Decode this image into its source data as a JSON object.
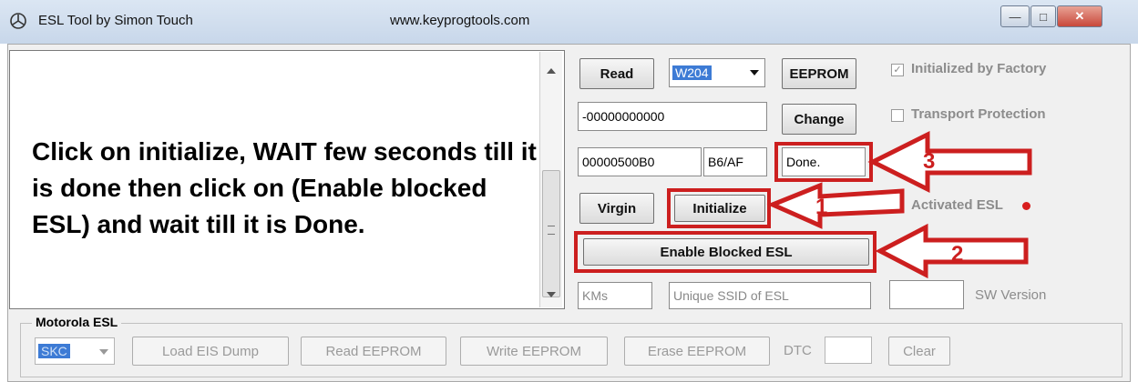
{
  "window": {
    "title": "ESL Tool by Simon Touch",
    "url": "www.keyprogtools.com"
  },
  "instructions": "Click on initialize, WAIT few seconds till it is done then click on (Enable blocked ESL) and wait till it is Done.",
  "controls": {
    "read_label": "Read",
    "model_value": "W204",
    "eeprom_label": "EEPROM",
    "initialized_label": "Initialized by Factory",
    "initialized_checked": true,
    "key_value": "-00000000000",
    "change_label": "Change",
    "transport_label": "Transport Protection",
    "transport_checked": false,
    "address_value": "00000500B0",
    "code_value": "B6/AF",
    "status_value": "Done.",
    "virgin_label": "Virgin",
    "initialize_label": "Initialize",
    "activated_label": "Activated ESL",
    "enable_blocked_label": "Enable Blocked ESL",
    "kms_placeholder": "KMs",
    "ssid_placeholder": "Unique SSID of ESL",
    "sw_version_label": "SW Version"
  },
  "annotations": {
    "arrow1": "1",
    "arrow2": "2",
    "arrow3": "3",
    "color": "#cc1f1f"
  },
  "motorola": {
    "group_title": "Motorola ESL",
    "skc_value": "SKC",
    "load_eis_label": "Load EIS Dump",
    "read_eeprom_label": "Read EEPROM",
    "write_eeprom_label": "Write EEPROM",
    "erase_eeprom_label": "Erase EEPROM",
    "dtc_label": "DTC",
    "clear_label": "Clear"
  }
}
